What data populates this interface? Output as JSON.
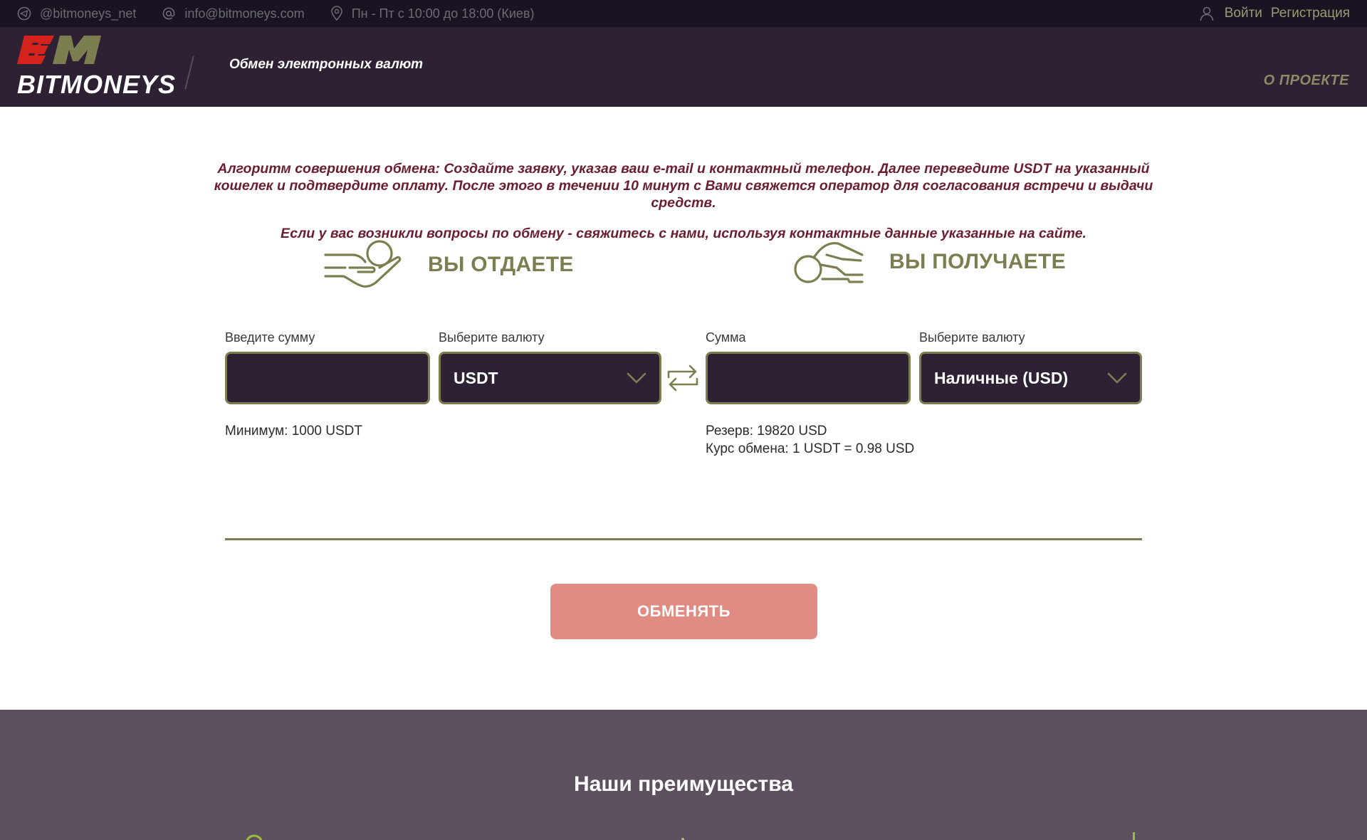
{
  "topbar": {
    "telegram": "@bitmoneys_net",
    "email": "info@bitmoneys.com",
    "hours": "Пн - Пт с 10:00 до 18:00 (Киев)",
    "login": "Войти",
    "register": "Регистрация"
  },
  "header": {
    "logo_text": "BITMONEYS",
    "logo_mark": "BM",
    "tagline": "Обмен электронных валют",
    "about": "О ПРОЕКТЕ"
  },
  "info": {
    "line1": "Алгоритм совершения обмена: Создайте заявку, указав ваш e-mail и контактный телефон. Далее переведите USDT на указанный кошелек и подтвердите оплату. После этого в течении 10 минут с Вами свяжется оператор для согласования встречи и выдачи средств.",
    "line2": "Если у вас возникли вопросы по обмену - свяжитесь с нами, используя контактные данные указанные на сайте."
  },
  "give": {
    "heading": "ВЫ ОТДАЕТЕ",
    "amount_label": "Введите сумму",
    "amount_value": "",
    "currency_label": "Выберите валюту",
    "currency_value": "USDT",
    "minimum": "Минимум: 1000 USDT"
  },
  "get": {
    "heading": "ВЫ ПОЛУЧАЕТЕ",
    "amount_label": "Сумма",
    "amount_value": "",
    "currency_label": "Выберите валюту",
    "currency_value": "Наличные (USD)",
    "reserve": "Резерв: 19820 USD",
    "rate": "Курс обмена: 1 USDT = 0.98 USD"
  },
  "action": {
    "exchange_button": "ОБМЕНЯТЬ"
  },
  "advantages": {
    "title": "Наши преимущества"
  },
  "colors": {
    "topbar_bg": "#1a1422",
    "header_bg": "#2e2133",
    "accent_olive": "#7d7e50",
    "info_text": "#6b1e2f",
    "button_bg": "#e08c83",
    "logo_red": "#d4231c",
    "footer_bg": "#5d5160"
  }
}
